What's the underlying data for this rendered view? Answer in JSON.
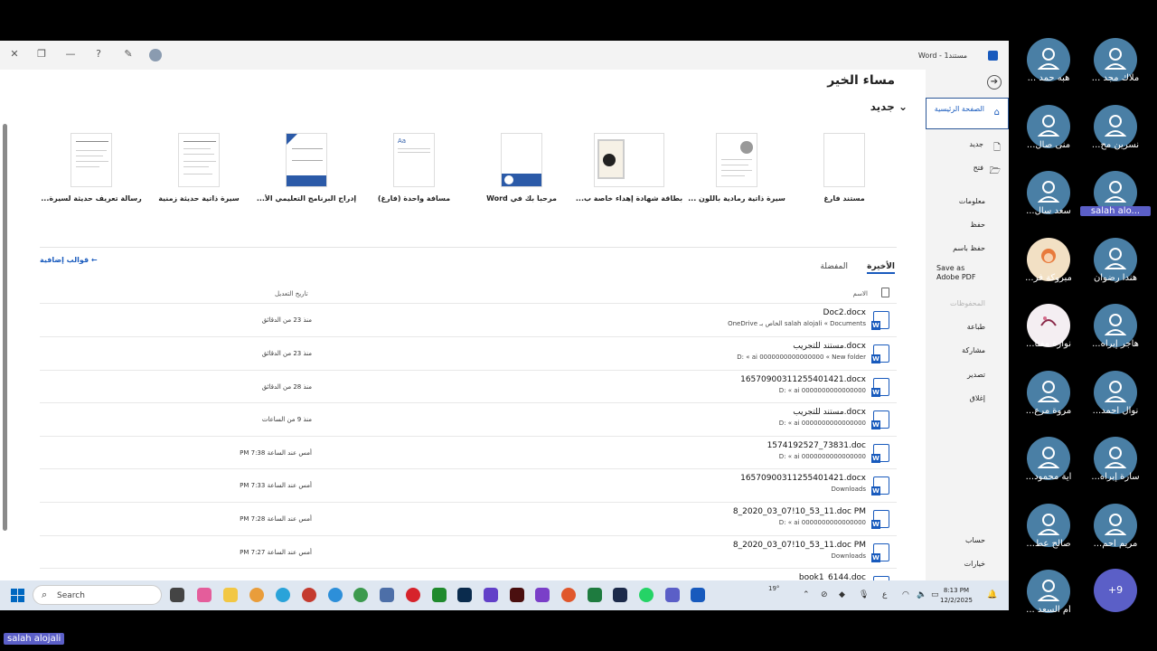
{
  "titlebar": {
    "app_title": "مستند1 - Word"
  },
  "sidebar": {
    "home": "الصفحة الرئيسية",
    "items": [
      "جديد",
      "فتح",
      "معلومات",
      "حفظ",
      "حفظ باسم",
      "Save as Adobe PDF",
      "المحفوظات",
      "طباعة",
      "مشاركة",
      "تصدير",
      "إغلاق"
    ],
    "bottom": [
      "حساب",
      "خيارات"
    ]
  },
  "main": {
    "greeting": "مساء الخير",
    "new_header": "جديد",
    "more_templates": "قوالب إضافية",
    "templates": [
      "مستند فارغ",
      "سيرة ذاتية رمادية باللون ...",
      "بطاقة شهادة إهداء خاصة ب...",
      "مرحباً بك في Word",
      "مسافة واحدة (فارغ)",
      "إدراج البرنامج التعليمي الأ...",
      "سيرة ذاتية حديثة زمنية",
      "رسالة تعريف حديثة لسيرة..."
    ],
    "tabs": {
      "recent": "الأخيرة",
      "favorites": "المفضلة"
    },
    "columns": {
      "name": "الاسم",
      "date": "تاريخ التعديل"
    },
    "files": [
      {
        "name": "Doc2.docx",
        "path": "OneDrive الخاص بـ salah alojali « Documents",
        "date": "منذ 23 من الدقائق"
      },
      {
        "name": "مستند للتجريب.docx",
        "path": "D: « ai 0000000000000000 « New folder",
        "date": "منذ 23 من الدقائق"
      },
      {
        "name": "16570900311255401421.docx",
        "path": "D: « ai 0000000000000000",
        "date": "منذ 28 من الدقائق"
      },
      {
        "name": "مستند للتجريب.docx",
        "path": "D: « ai 0000000000000000",
        "date": "منذ 9 من الساعات"
      },
      {
        "name": "1574192527_73831.doc",
        "path": "D: « ai 0000000000000000",
        "date": "أمس عند الساعة 7:38 PM"
      },
      {
        "name": "16570900311255401421.docx",
        "path": "Downloads",
        "date": "أمس عند الساعة 7:33 PM"
      },
      {
        "name": "8_2020_03_07!10_53_11.doc PM",
        "path": "D: « ai 0000000000000000",
        "date": "أمس عند الساعة 7:28 PM"
      },
      {
        "name": "8_2020_03_07!10_53_11.doc PM",
        "path": "Downloads",
        "date": "أمس عند الساعة 7:27 PM"
      },
      {
        "name": "book1_6144.doc",
        "path": "",
        "date": ""
      }
    ]
  },
  "taskbar": {
    "search_placeholder": "Search",
    "time": "8:13 PM",
    "date": "12/2/2025",
    "weather": "19°",
    "lang": "ع"
  },
  "participants": [
    {
      "name": "ملاك مجد ..."
    },
    {
      "name": "هبه حمد ..."
    },
    {
      "name": "نسرين مح..."
    },
    {
      "name": "منى صال..."
    },
    {
      "name": "salah alo..."
    },
    {
      "name": "سعد سال..."
    },
    {
      "name": "هندا رضوان"
    },
    {
      "name": "مبروكة فر..."
    },
    {
      "name": "هاجر إبراه..."
    },
    {
      "name": "نوارة مفتا..."
    },
    {
      "name": "نوال احمد..."
    },
    {
      "name": "مروة مرع..."
    },
    {
      "name": "سارة إبراه..."
    },
    {
      "name": "آية محمود..."
    },
    {
      "name": "مريم احم..."
    },
    {
      "name": "صالح عط..."
    },
    {
      "name": "أم السعد ..."
    }
  ],
  "more_participants": "+9",
  "active_speaker": "salah alojali"
}
